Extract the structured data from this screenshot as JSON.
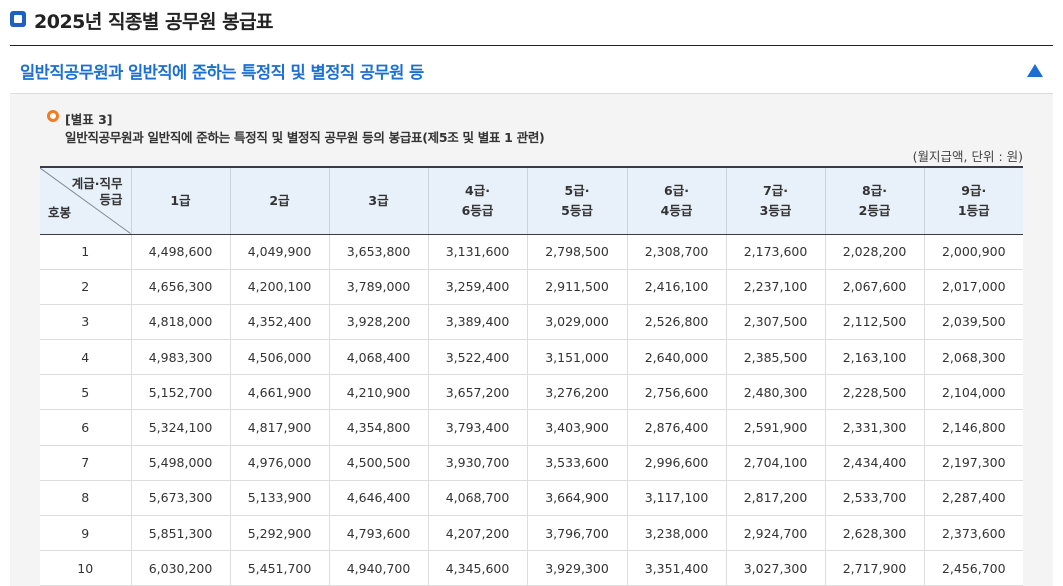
{
  "header": {
    "title": "2025년 직종별 공무원 봉급표"
  },
  "accordion": {
    "title": "일반직공무원과 일반직에 준하는 특정직 및 별정직 공무원 등"
  },
  "annex": {
    "label": "[별표 3]",
    "description": "일반직공무원과 일반직에 준하는 특정직 및 별정직 공무원 등의 봉급표(제5조 및 별표 1 관련)",
    "unit": "(월지급액, 단위 : 원)"
  },
  "table": {
    "corner_top_line1": "계급·직무",
    "corner_top_line2": "등급",
    "corner_bottom": "호봉",
    "columns": [
      {
        "line1": "1급",
        "line2": ""
      },
      {
        "line1": "2급",
        "line2": ""
      },
      {
        "line1": "3급",
        "line2": ""
      },
      {
        "line1": "4급·",
        "line2": "6등급"
      },
      {
        "line1": "5급·",
        "line2": "5등급"
      },
      {
        "line1": "6급·",
        "line2": "4등급"
      },
      {
        "line1": "7급·",
        "line2": "3등급"
      },
      {
        "line1": "8급·",
        "line2": "2등급"
      },
      {
        "line1": "9급·",
        "line2": "1등급"
      }
    ],
    "rows": [
      [
        "1",
        "4,498,600",
        "4,049,900",
        "3,653,800",
        "3,131,600",
        "2,798,500",
        "2,308,700",
        "2,173,600",
        "2,028,200",
        "2,000,900"
      ],
      [
        "2",
        "4,656,300",
        "4,200,100",
        "3,789,000",
        "3,259,400",
        "2,911,500",
        "2,416,100",
        "2,237,100",
        "2,067,600",
        "2,017,000"
      ],
      [
        "3",
        "4,818,000",
        "4,352,400",
        "3,928,200",
        "3,389,400",
        "3,029,000",
        "2,526,800",
        "2,307,500",
        "2,112,500",
        "2,039,500"
      ],
      [
        "4",
        "4,983,300",
        "4,506,000",
        "4,068,400",
        "3,522,400",
        "3,151,000",
        "2,640,000",
        "2,385,500",
        "2,163,100",
        "2,068,300"
      ],
      [
        "5",
        "5,152,700",
        "4,661,900",
        "4,210,900",
        "3,657,200",
        "3,276,200",
        "2,756,600",
        "2,480,300",
        "2,228,500",
        "2,104,000"
      ],
      [
        "6",
        "5,324,100",
        "4,817,900",
        "4,354,800",
        "3,793,400",
        "3,403,900",
        "2,876,400",
        "2,591,900",
        "2,331,300",
        "2,146,800"
      ],
      [
        "7",
        "5,498,000",
        "4,976,000",
        "4,500,500",
        "3,930,700",
        "3,533,600",
        "2,996,600",
        "2,704,100",
        "2,434,400",
        "2,197,300"
      ],
      [
        "8",
        "5,673,300",
        "5,133,900",
        "4,646,400",
        "4,068,700",
        "3,664,900",
        "3,117,100",
        "2,817,200",
        "2,533,700",
        "2,287,400"
      ],
      [
        "9",
        "5,851,300",
        "5,292,900",
        "4,793,600",
        "4,207,200",
        "3,796,700",
        "3,238,000",
        "2,924,700",
        "2,628,300",
        "2,373,600"
      ],
      [
        "10",
        "6,030,200",
        "5,451,700",
        "4,940,700",
        "4,345,600",
        "3,929,300",
        "3,351,400",
        "3,027,300",
        "2,717,900",
        "2,456,700"
      ]
    ]
  },
  "colors": {
    "accent": "#1a6fd1",
    "header_icon": "#1e5fbf",
    "bullet": "#f47b20",
    "table_header_bg": "#e8f0fa"
  }
}
